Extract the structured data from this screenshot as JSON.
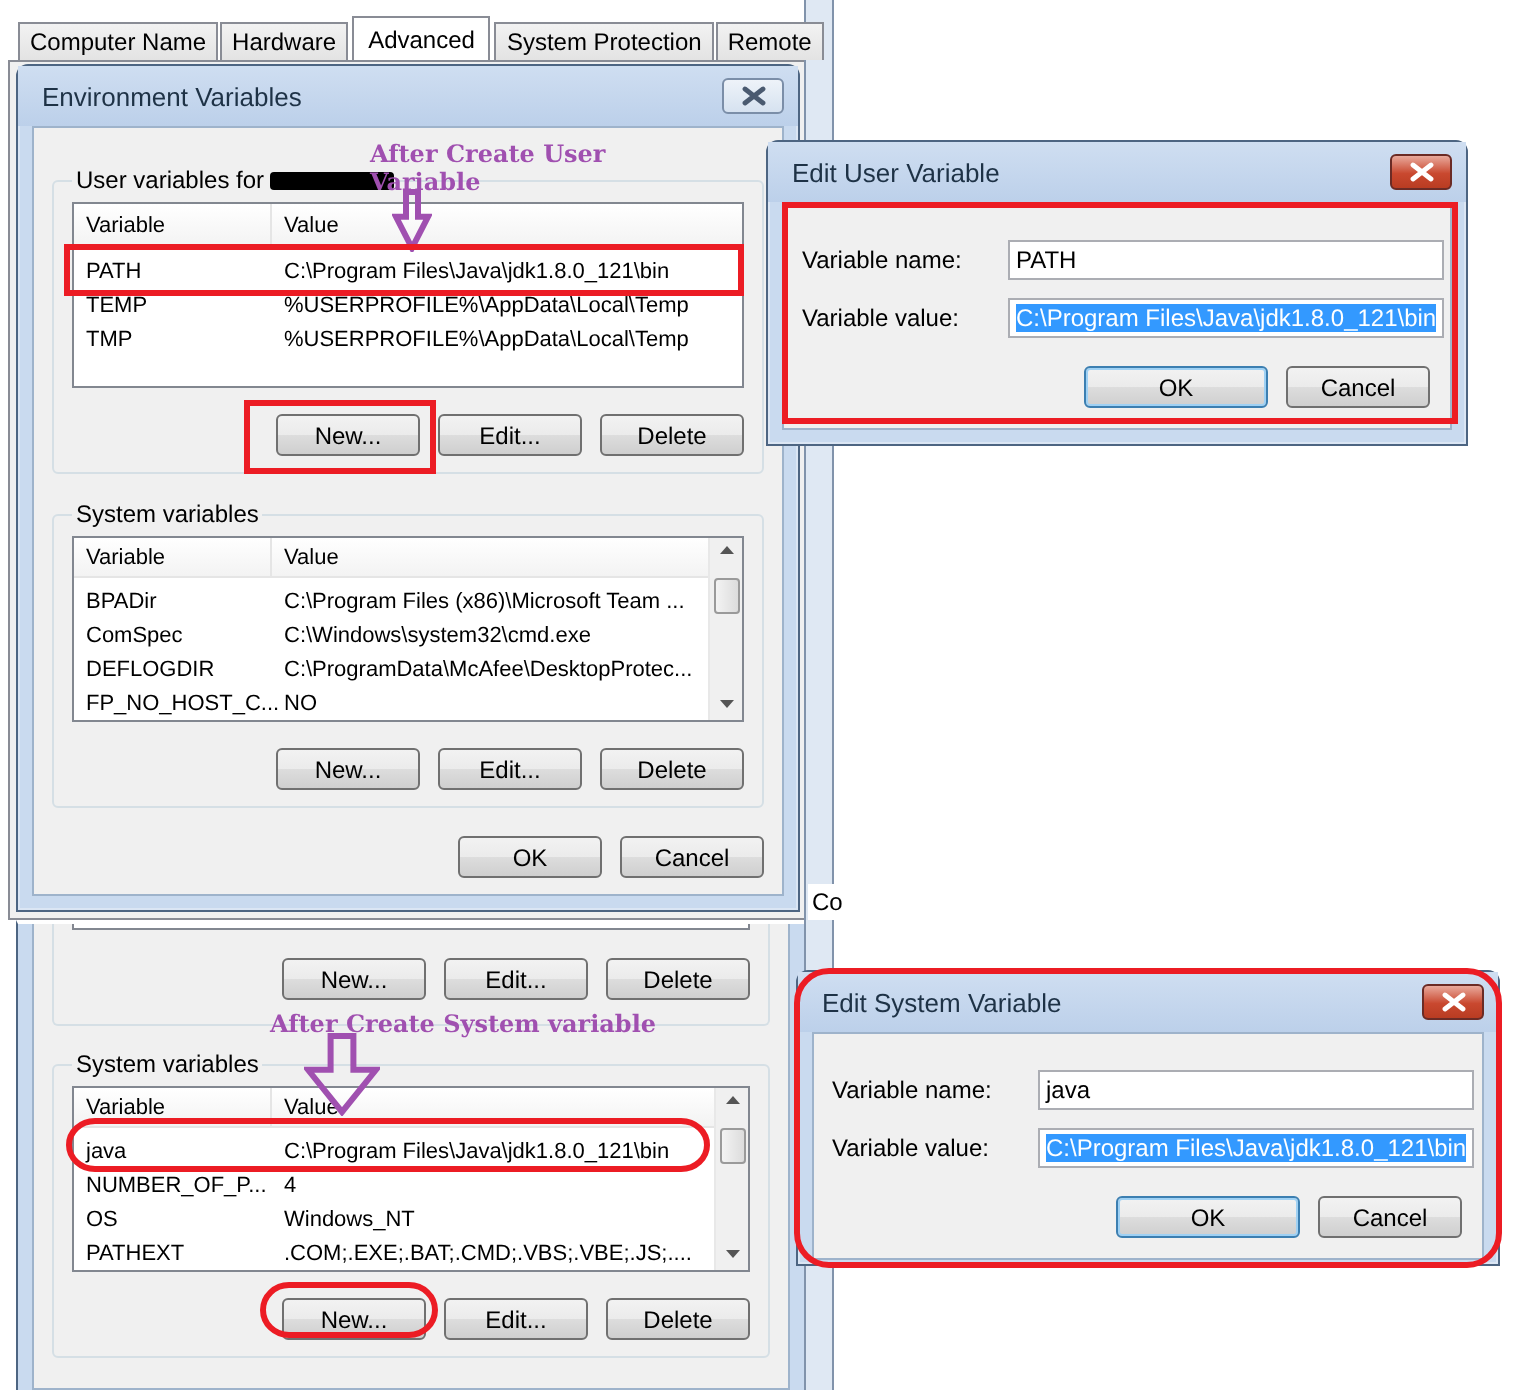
{
  "tabs": [
    {
      "label": "Computer Name",
      "selected": false
    },
    {
      "label": "Hardware",
      "selected": false
    },
    {
      "label": "Advanced",
      "selected": true
    },
    {
      "label": "System Protection",
      "selected": false
    },
    {
      "label": "Remote",
      "selected": false
    }
  ],
  "environment_dialog": {
    "title": "Environment Variables",
    "user_variables": {
      "label": "User variables for",
      "name_redacted": true,
      "columns": [
        "Variable",
        "Value"
      ],
      "rows": [
        {
          "variable": "PATH",
          "value": "C:\\Program Files\\Java\\jdk1.8.0_121\\bin"
        },
        {
          "variable": "TEMP",
          "value": "%USERPROFILE%\\AppData\\Local\\Temp"
        },
        {
          "variable": "TMP",
          "value": "%USERPROFILE%\\AppData\\Local\\Temp"
        }
      ],
      "buttons": [
        "New...",
        "Edit...",
        "Delete"
      ]
    },
    "system_variables": {
      "label": "System variables",
      "name_redacted": false,
      "columns": [
        "Variable",
        "Value"
      ],
      "rows": [
        {
          "variable": "BPADir",
          "value": "C:\\Program Files (x86)\\Microsoft Team ..."
        },
        {
          "variable": "ComSpec",
          "value": "C:\\Windows\\system32\\cmd.exe"
        },
        {
          "variable": "DEFLOGDIR",
          "value": "C:\\ProgramData\\McAfee\\DesktopProtec..."
        },
        {
          "variable": "FP_NO_HOST_C...",
          "value": "NO"
        }
      ],
      "buttons": [
        "New...",
        "Edit...",
        "Delete"
      ]
    },
    "buttons": [
      "OK",
      "Cancel"
    ]
  },
  "background_text": "Co",
  "second_capture": {
    "user_buttons": [
      "New...",
      "Edit...",
      "Delete"
    ],
    "system_variables": {
      "label": "System variables",
      "name_redacted": false,
      "columns": [
        "Variable",
        "Value"
      ],
      "rows": [
        {
          "variable": "java",
          "value": "C:\\Program Files\\Java\\jdk1.8.0_121\\bin"
        },
        {
          "variable": "NUMBER_OF_P...",
          "value": "4"
        },
        {
          "variable": "OS",
          "value": "Windows_NT"
        },
        {
          "variable": "PATHEXT",
          "value": ".COM;.EXE;.BAT;.CMD;.VBS;.VBE;.JS;...."
        }
      ],
      "buttons": [
        "New...",
        "Edit...",
        "Delete"
      ]
    }
  },
  "edit_user_variable": {
    "title": "Edit User Variable",
    "fields": [
      {
        "label": "Variable name:",
        "value": "PATH",
        "selected": false
      },
      {
        "label": "Variable value:",
        "value": "C:\\Program Files\\Java\\jdk1.8.0_121\\bin",
        "selected": true
      }
    ],
    "buttons": [
      "OK",
      "Cancel"
    ]
  },
  "edit_system_variable": {
    "title": "Edit System Variable",
    "fields": [
      {
        "label": "Variable name:",
        "value": "java",
        "selected": false
      },
      {
        "label": "Variable value:",
        "value": "C:\\Program Files\\Java\\jdk1.8.0_121\\bin",
        "selected": true
      }
    ],
    "buttons": [
      "OK",
      "Cancel"
    ]
  },
  "annotations": [
    {
      "text": "After Create User Variable"
    },
    {
      "text": "After Create System variable"
    }
  ]
}
